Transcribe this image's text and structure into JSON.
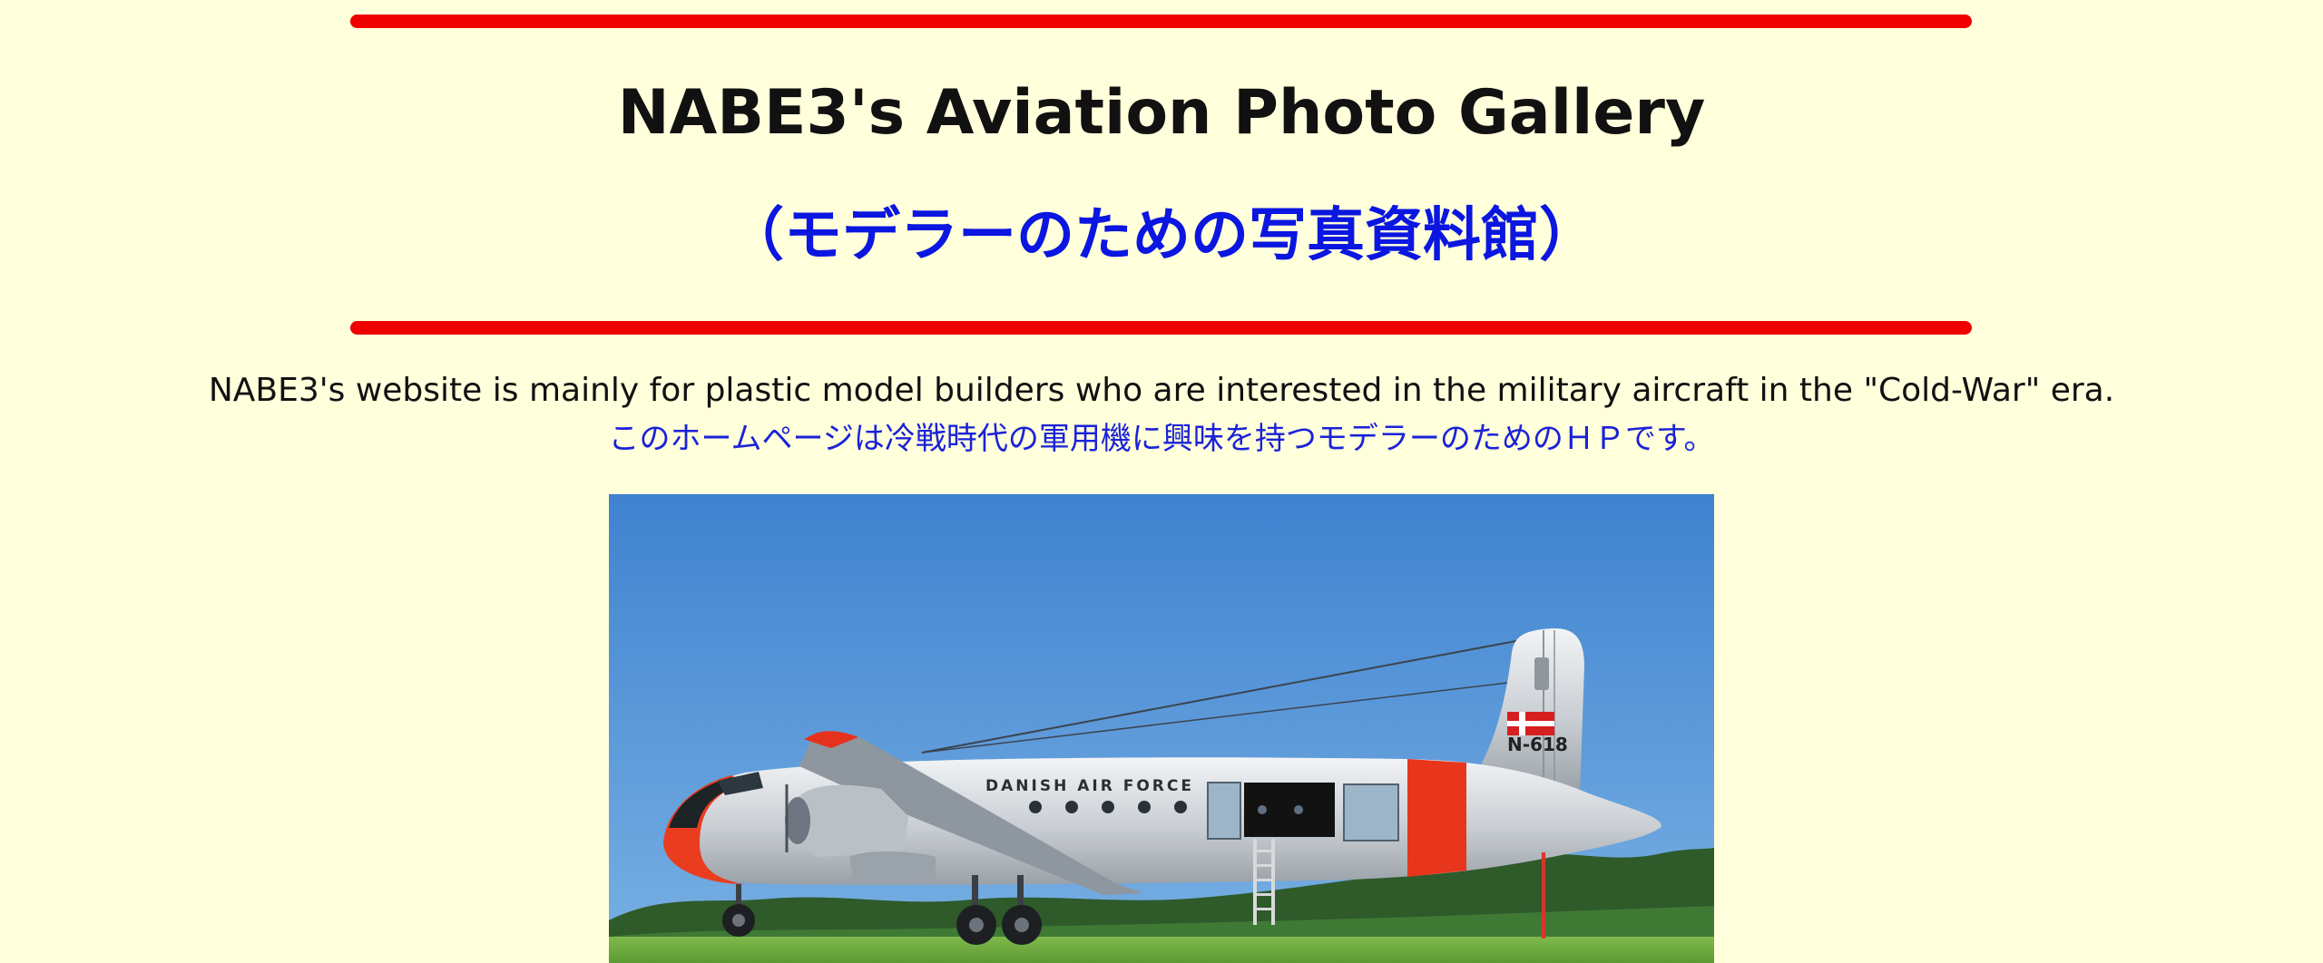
{
  "header": {
    "title": "NABE3's Aviation Photo Gallery",
    "subtitle": "（モデラーのための写真資料館）"
  },
  "intro": {
    "english": "NABE3's website is mainly for plastic model builders who are interested in the military aircraft in the \"Cold-War\" era.",
    "japanese": "このホームページは冷戦時代の軍用機に興味を持つモデラーのためのＨＰです。"
  },
  "photo": {
    "fuselage_text": "DANISH AIR FORCE",
    "tail_code": "N-618"
  },
  "colors": {
    "background": "#ffffdc",
    "rule": "#ee0000",
    "title": "#111111",
    "japanese_text": "#0b16e0"
  }
}
